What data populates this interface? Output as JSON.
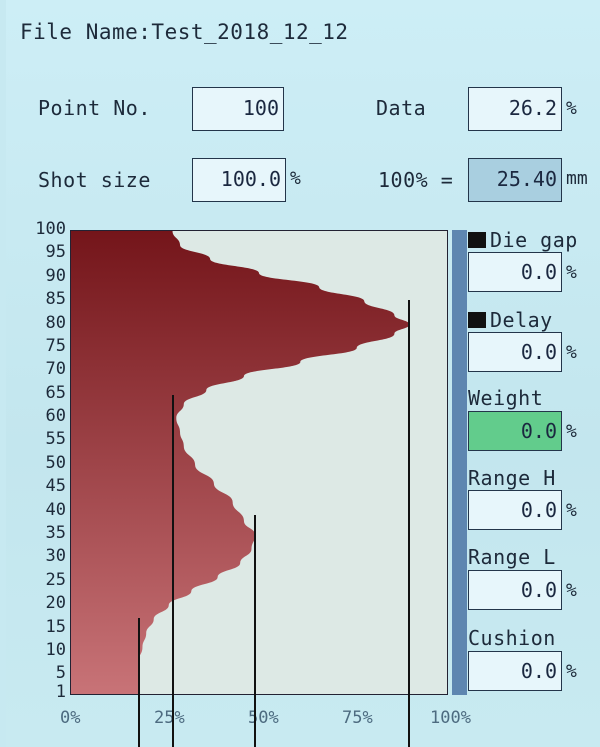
{
  "header": {
    "file_name": "File Name:Test_2018_12_12"
  },
  "fields": {
    "point_no": {
      "label": "Point No.",
      "value": "100"
    },
    "data": {
      "label": "Data",
      "value": "26.2",
      "unit": "%"
    },
    "shot_size": {
      "label": "Shot size",
      "value": "100.0",
      "unit": "%"
    },
    "full_scale": {
      "label": "100% =",
      "value": "25.40",
      "unit": "mm"
    }
  },
  "side": {
    "die_gap": {
      "label": "Die gap",
      "value": "0.0",
      "unit": "%"
    },
    "delay": {
      "label": "Delay",
      "value": "0.0",
      "unit": "%"
    },
    "weight": {
      "label": "Weight",
      "value": "0.0",
      "unit": "%"
    },
    "range_h": {
      "label": "Range H",
      "value": "0.0",
      "unit": "%"
    },
    "range_l": {
      "label": "Range L",
      "value": "0.0",
      "unit": "%"
    },
    "cushion": {
      "label": "Cushion",
      "value": "0.0",
      "unit": "%"
    }
  },
  "colors": {
    "fill_dark": "#7a1818",
    "fill_light": "#c76c70",
    "plot_bg": "#dde9e5",
    "weight_box": "#62cc8c"
  },
  "chart_data": {
    "type": "area",
    "y_ticks": [
      "100",
      "95",
      "90",
      "85",
      "80",
      "75",
      "70",
      "65",
      "60",
      "55",
      "50",
      "45",
      "40",
      "35",
      "30",
      "25",
      "20",
      "15",
      "10",
      "5",
      "1"
    ],
    "x_ticks": [
      "0%",
      "25%",
      "50%",
      "75%",
      "100%"
    ],
    "ylim": [
      1,
      100
    ],
    "xlim": [
      0,
      100
    ],
    "profile": [
      [
        100,
        27
      ],
      [
        97,
        29
      ],
      [
        94,
        37
      ],
      [
        91,
        50
      ],
      [
        88,
        66
      ],
      [
        85,
        78
      ],
      [
        82,
        86
      ],
      [
        80,
        90
      ],
      [
        78,
        86
      ],
      [
        75,
        76
      ],
      [
        72,
        61
      ],
      [
        69,
        46
      ],
      [
        66,
        36
      ],
      [
        63,
        30
      ],
      [
        60,
        28
      ],
      [
        57,
        29
      ],
      [
        54,
        30
      ],
      [
        50,
        33
      ],
      [
        46,
        38
      ],
      [
        42,
        43
      ],
      [
        38,
        46
      ],
      [
        35,
        49
      ],
      [
        32,
        48
      ],
      [
        29,
        45
      ],
      [
        26,
        39
      ],
      [
        23,
        32
      ],
      [
        20,
        26
      ],
      [
        17,
        22
      ],
      [
        14,
        20
      ],
      [
        11,
        19
      ],
      [
        8,
        18
      ],
      [
        5,
        18
      ],
      [
        1,
        18
      ]
    ],
    "markers_x": [
      18,
      27,
      49,
      90
    ]
  }
}
